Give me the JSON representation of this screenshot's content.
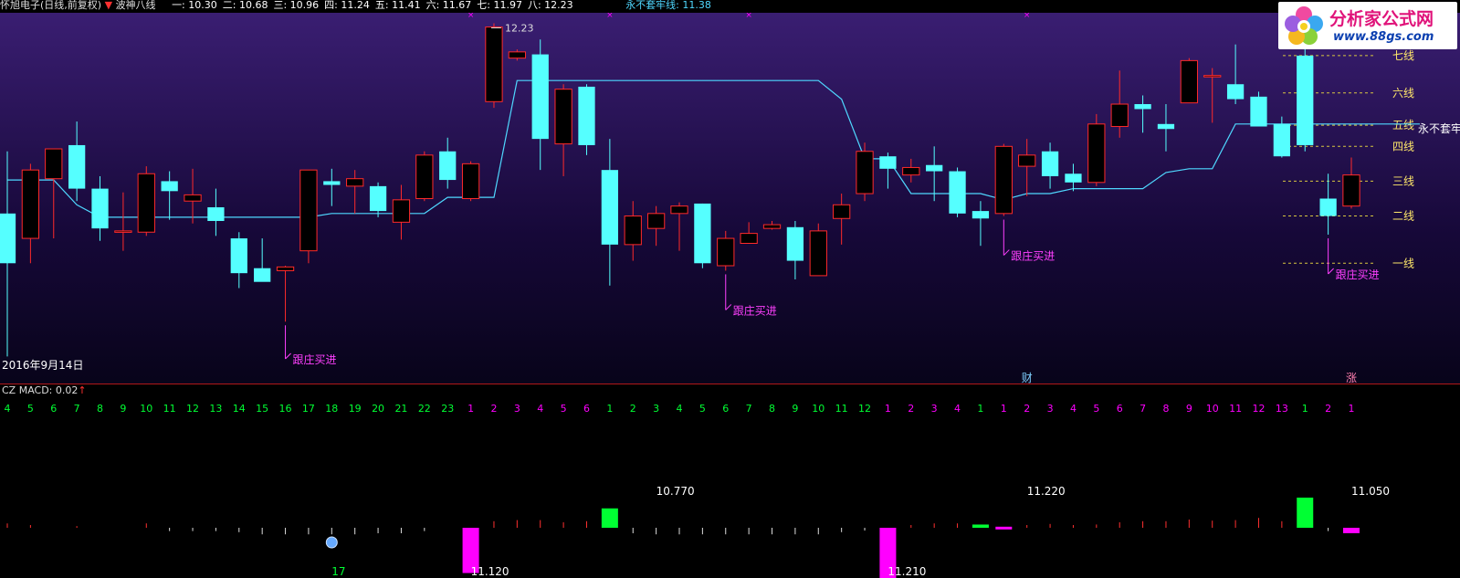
{
  "header": {
    "title": "怀旭电子(日线,前复权)",
    "arrow": "▼",
    "indicator_name": "波神八线",
    "levels": [
      {
        "label": "一: 10.30",
        "color": "#ffffff"
      },
      {
        "label": "二: 10.68",
        "color": "#ffffff"
      },
      {
        "label": "三: 10.96",
        "color": "#ffffff"
      },
      {
        "label": "四: 11.24",
        "color": "#ffffff"
      },
      {
        "label": "五: 11.41",
        "color": "#ffffff"
      },
      {
        "label": "六: 11.67",
        "color": "#ffffff"
      },
      {
        "label": "七: 11.97",
        "color": "#ffffff"
      },
      {
        "label": "八: 12.23",
        "color": "#ffffff"
      }
    ],
    "trap_label": "永不套牢线: 11.38",
    "trap_color": "#4fd8ff"
  },
  "logo": {
    "title": "分析家公式网",
    "url": "www.88gs.com"
  },
  "date_label": "2016年9月14日",
  "lower_title": "CZ  MACD: 0.02",
  "lower_title_arrow": "↑",
  "colors": {
    "up": "#ff2a2a",
    "down": "#55ffff",
    "trap_line": "#4fd8ff",
    "level_line": "#d7c640",
    "buy_signal": "#ff40ff",
    "magenta": "#ff00ff",
    "green": "#00ff33"
  },
  "chart_data": [
    {
      "type": "candlestick",
      "title": "怀旭电子(日线,前复权)",
      "ylim": [
        9.45,
        12.3
      ],
      "candles": [
        {
          "o": 10.7,
          "h": 11.2,
          "l": 9.55,
          "c": 10.3
        },
        {
          "o": 10.5,
          "h": 11.1,
          "l": 10.3,
          "c": 11.05
        },
        {
          "o": 10.98,
          "h": 11.12,
          "l": 10.5,
          "c": 11.22
        },
        {
          "o": 11.25,
          "h": 11.44,
          "l": 10.8,
          "c": 10.9
        },
        {
          "o": 10.9,
          "h": 11.0,
          "l": 10.48,
          "c": 10.58
        },
        {
          "o": 10.56,
          "h": 10.87,
          "l": 10.4,
          "c": 10.56
        },
        {
          "o": 10.55,
          "h": 11.08,
          "l": 10.52,
          "c": 11.02
        },
        {
          "o": 10.96,
          "h": 11.04,
          "l": 10.65,
          "c": 10.88
        },
        {
          "o": 10.8,
          "h": 11.06,
          "l": 10.62,
          "c": 10.85
        },
        {
          "o": 10.75,
          "h": 10.9,
          "l": 10.52,
          "c": 10.64
        },
        {
          "o": 10.5,
          "h": 10.55,
          "l": 10.1,
          "c": 10.22
        },
        {
          "o": 10.26,
          "h": 10.5,
          "l": 10.17,
          "c": 10.15
        },
        {
          "o": 10.24,
          "h": 10.28,
          "l": 9.83,
          "c": 10.27
        },
        {
          "o": 10.4,
          "h": 10.95,
          "l": 10.3,
          "c": 11.05
        },
        {
          "o": 10.96,
          "h": 11.06,
          "l": 10.76,
          "c": 10.93
        },
        {
          "o": 10.92,
          "h": 11.05,
          "l": 10.7,
          "c": 10.98
        },
        {
          "o": 10.92,
          "h": 10.95,
          "l": 10.67,
          "c": 10.72
        },
        {
          "o": 10.63,
          "h": 10.93,
          "l": 10.49,
          "c": 10.81
        },
        {
          "o": 10.82,
          "h": 11.2,
          "l": 10.8,
          "c": 11.17
        },
        {
          "o": 11.2,
          "h": 11.31,
          "l": 10.9,
          "c": 10.97
        },
        {
          "o": 10.82,
          "h": 11.12,
          "l": 10.8,
          "c": 11.1
        },
        {
          "o": 11.6,
          "h": 12.23,
          "l": 11.55,
          "c": 12.2
        },
        {
          "o": 11.95,
          "h": 12.02,
          "l": 11.93,
          "c": 12.0
        },
        {
          "o": 11.98,
          "h": 12.1,
          "l": 11.05,
          "c": 11.3
        },
        {
          "o": 11.26,
          "h": 11.74,
          "l": 11.0,
          "c": 11.7
        },
        {
          "o": 11.72,
          "h": 11.74,
          "l": 11.17,
          "c": 11.25
        },
        {
          "o": 11.05,
          "h": 11.3,
          "l": 10.12,
          "c": 10.45
        },
        {
          "o": 10.45,
          "h": 10.8,
          "l": 10.32,
          "c": 10.68
        },
        {
          "o": 10.58,
          "h": 10.76,
          "l": 10.44,
          "c": 10.7
        },
        {
          "o": 10.7,
          "h": 10.79,
          "l": 10.4,
          "c": 10.76
        },
        {
          "o": 10.78,
          "h": 10.78,
          "l": 10.26,
          "c": 10.3
        },
        {
          "o": 10.28,
          "h": 10.56,
          "l": 10.24,
          "c": 10.5
        },
        {
          "o": 10.46,
          "h": 10.63,
          "l": 10.46,
          "c": 10.54
        },
        {
          "o": 10.58,
          "h": 10.64,
          "l": 10.57,
          "c": 10.61
        },
        {
          "o": 10.59,
          "h": 10.64,
          "l": 10.17,
          "c": 10.32
        },
        {
          "o": 10.2,
          "h": 10.62,
          "l": 10.2,
          "c": 10.56
        },
        {
          "o": 10.66,
          "h": 10.86,
          "l": 10.45,
          "c": 10.77
        },
        {
          "o": 10.86,
          "h": 11.27,
          "l": 10.8,
          "c": 11.2
        },
        {
          "o": 11.16,
          "h": 11.19,
          "l": 10.9,
          "c": 11.06
        },
        {
          "o": 11.01,
          "h": 11.14,
          "l": 10.95,
          "c": 11.07
        },
        {
          "o": 11.09,
          "h": 11.24,
          "l": 10.8,
          "c": 11.04
        },
        {
          "o": 11.04,
          "h": 11.07,
          "l": 10.67,
          "c": 10.7
        },
        {
          "o": 10.72,
          "h": 10.8,
          "l": 10.44,
          "c": 10.66
        },
        {
          "o": 10.7,
          "h": 11.26,
          "l": 10.68,
          "c": 11.24
        },
        {
          "o": 11.08,
          "h": 11.3,
          "l": 10.84,
          "c": 11.17
        },
        {
          "o": 11.2,
          "h": 11.27,
          "l": 10.9,
          "c": 11.0
        },
        {
          "o": 11.02,
          "h": 11.1,
          "l": 10.88,
          "c": 10.95
        },
        {
          "o": 10.95,
          "h": 11.5,
          "l": 10.92,
          "c": 11.42
        },
        {
          "o": 11.4,
          "h": 11.85,
          "l": 11.31,
          "c": 11.58
        },
        {
          "o": 11.58,
          "h": 11.65,
          "l": 11.35,
          "c": 11.54
        },
        {
          "o": 11.42,
          "h": 11.58,
          "l": 11.2,
          "c": 11.38
        },
        {
          "o": 11.59,
          "h": 11.95,
          "l": 11.59,
          "c": 11.93
        },
        {
          "o": 11.81,
          "h": 11.87,
          "l": 11.43,
          "c": 11.81
        },
        {
          "o": 11.74,
          "h": 12.06,
          "l": 11.58,
          "c": 11.62
        },
        {
          "o": 11.64,
          "h": 11.68,
          "l": 11.45,
          "c": 11.4
        },
        {
          "o": 11.42,
          "h": 11.48,
          "l": 11.15,
          "c": 11.16
        },
        {
          "o": 11.97,
          "h": 12.16,
          "l": 11.2,
          "c": 11.25
        },
        {
          "o": 10.82,
          "h": 11.02,
          "l": 10.53,
          "c": 10.68
        },
        {
          "o": 10.76,
          "h": 11.15,
          "l": 10.74,
          "c": 11.01
        }
      ],
      "trap_line": [
        10.97,
        10.97,
        10.97,
        10.77,
        10.67,
        10.67,
        10.67,
        10.67,
        10.67,
        10.67,
        10.67,
        10.67,
        10.67,
        10.67,
        10.7,
        10.7,
        10.7,
        10.7,
        10.7,
        10.83,
        10.83,
        10.83,
        11.77,
        11.77,
        11.77,
        11.77,
        11.77,
        11.77,
        11.77,
        11.77,
        11.77,
        11.77,
        11.77,
        11.77,
        11.77,
        11.77,
        11.62,
        11.14,
        11.14,
        10.86,
        10.86,
        10.86,
        10.86,
        10.81,
        10.86,
        10.86,
        10.9,
        10.9,
        10.9,
        10.9,
        11.03,
        11.06,
        11.06,
        11.42,
        11.42,
        11.42,
        11.42,
        11.42,
        11.42
      ],
      "levels": [
        {
          "name": "一线",
          "value": 10.3
        },
        {
          "name": "二线",
          "value": 10.68
        },
        {
          "name": "三线",
          "value": 10.96
        },
        {
          "name": "四线",
          "value": 11.24
        },
        {
          "name": "五线",
          "value": 11.41
        },
        {
          "name": "六线",
          "value": 11.67
        },
        {
          "name": "七线",
          "value": 11.97
        }
      ],
      "right_label": "永不套牢",
      "annotations": [
        {
          "text": "跟庄买进",
          "index": 12
        },
        {
          "text": "跟庄买进",
          "index": 31
        },
        {
          "text": "跟庄买进",
          "index": 43
        },
        {
          "text": "跟庄买进",
          "index": 57
        }
      ],
      "high_label": {
        "text": "12.23",
        "index": 21
      },
      "bottom_markers": [
        {
          "text": "财",
          "index": 44
        },
        {
          "text": "涨",
          "index": 58
        }
      ]
    },
    {
      "type": "bar",
      "title": "CZ MACD",
      "counts": [
        "4",
        "5",
        "6",
        "7",
        "8",
        "9",
        "10",
        "11",
        "12",
        "13",
        "14",
        "15",
        "16",
        "17",
        "18",
        "19",
        "20",
        "21",
        "22",
        "23",
        "1",
        "2",
        "3",
        "4",
        "5",
        "6",
        "1",
        "2",
        "3",
        "4",
        "5",
        "6",
        "7",
        "8",
        "9",
        "10",
        "11",
        "12",
        "1",
        "2",
        "3",
        "4",
        "1",
        "1",
        "2",
        "3",
        "4",
        "5",
        "6",
        "7",
        "8",
        "9",
        "10",
        "11",
        "12",
        "13",
        "1",
        "2",
        "1"
      ],
      "count_colors": [
        "g",
        "g",
        "g",
        "g",
        "g",
        "g",
        "g",
        "g",
        "g",
        "g",
        "g",
        "g",
        "g",
        "g",
        "g",
        "g",
        "g",
        "g",
        "g",
        "g",
        "m",
        "m",
        "m",
        "m",
        "m",
        "m",
        "g",
        "g",
        "g",
        "g",
        "g",
        "g",
        "g",
        "g",
        "g",
        "g",
        "g",
        "g",
        "m",
        "m",
        "m",
        "m",
        "g",
        "m",
        "m",
        "m",
        "m",
        "m",
        "m",
        "m",
        "m",
        "m",
        "m",
        "m",
        "m",
        "m",
        "g",
        "m",
        "m"
      ],
      "ticks": [
        0.08,
        0.05,
        0,
        0.03,
        0,
        0,
        0.08,
        -0.06,
        -0.06,
        -0.06,
        -0.08,
        -0.12,
        -0.12,
        -0.12,
        -0.12,
        -0.12,
        -0.1,
        -0.1,
        -0.06,
        0,
        0,
        0.12,
        0.14,
        0.14,
        0.1,
        0.12,
        0,
        -0.1,
        -0.12,
        -0.12,
        -0.12,
        -0.12,
        -0.12,
        -0.12,
        -0.12,
        -0.12,
        -0.08,
        -0.05,
        0,
        0.05,
        0.08,
        0.08,
        0,
        0,
        0.05,
        0.07,
        0.05,
        0.06,
        0.1,
        0.12,
        0.12,
        0.15,
        0.13,
        0.14,
        0.18,
        0.12,
        0,
        -0.06,
        -0.06
      ],
      "bars": [
        {
          "index": 20,
          "value": -0.42,
          "color": "#ff00ff",
          "width": 18
        },
        {
          "index": 26,
          "value": 0.18,
          "color": "#00ff33",
          "width": 18
        },
        {
          "index": 38,
          "value": -0.5,
          "color": "#ff00ff",
          "width": 18
        },
        {
          "index": 42,
          "value": 0.03,
          "color": "#00ff33",
          "width": 18
        },
        {
          "index": 43,
          "value": 0.01,
          "color": "#ff00ff",
          "width": 18
        },
        {
          "index": 56,
          "value": 0.28,
          "color": "#00ff33",
          "width": 18
        },
        {
          "index": 58,
          "value": -0.05,
          "color": "#ff00ff",
          "width": 18
        }
      ],
      "value_labels": [
        {
          "text": "10.770",
          "index": 28,
          "position": "top"
        },
        {
          "text": "11.220",
          "index": 44,
          "position": "top"
        },
        {
          "text": "11.050",
          "index": 58,
          "position": "top"
        },
        {
          "text": "11.120",
          "index": 20,
          "position": "bottom"
        },
        {
          "text": "11.210",
          "index": 38,
          "position": "bottom"
        },
        {
          "text": "17",
          "index": 14,
          "position": "bottom"
        }
      ],
      "dot": {
        "index": 14,
        "color": "#66aaff"
      }
    }
  ]
}
